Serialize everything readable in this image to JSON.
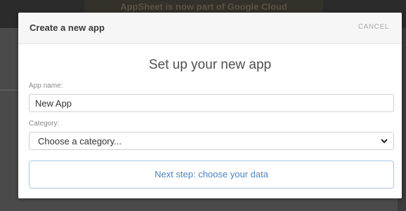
{
  "backdrop": {
    "banner_text": "AppSheet is now part of Google Cloud"
  },
  "modal": {
    "title": "Create a new app",
    "cancel_label": "CANCEL",
    "heading": "Set up your new app",
    "app_name": {
      "label": "App name:",
      "value": "New App"
    },
    "category": {
      "label": "Category:",
      "selected": "Choose a category...",
      "chevron_icon": "chevron-down-icon"
    },
    "next_button_label": "Next step: choose your data"
  },
  "colors": {
    "accent_text": "#4a84bf",
    "accent_border": "#a8c6e0",
    "header_bg": "#f6f6f6"
  }
}
